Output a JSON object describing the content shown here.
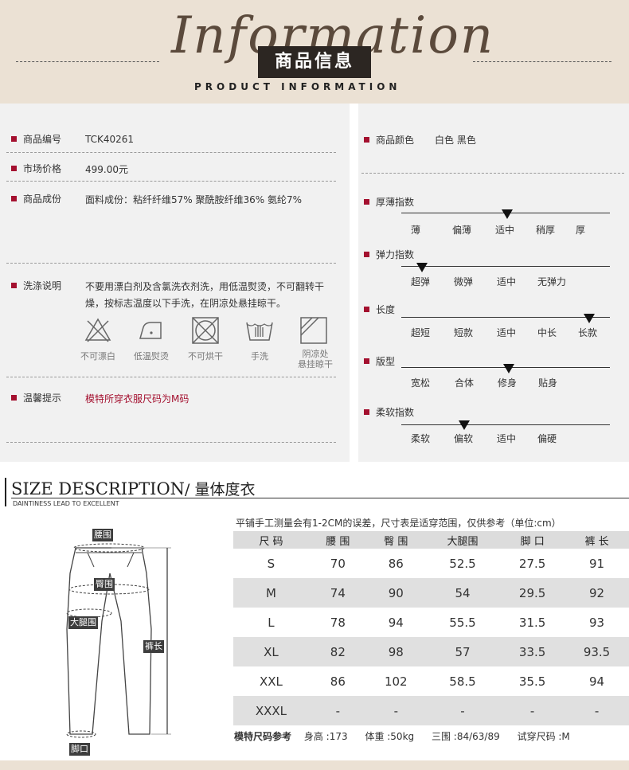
{
  "header": {
    "script_word": "Information",
    "title": "商品信息",
    "subtitle": "PRODUCT INFORMATION"
  },
  "left_panel": {
    "rows": [
      {
        "label": "商品编号",
        "value": "TCK40261"
      },
      {
        "label": "市场价格",
        "value": "499.00元"
      },
      {
        "label": "商品成份",
        "value": "面料成份：粘纤纤维57%  聚酰胺纤维36%  氨纶7%"
      },
      {
        "label": "洗涤说明",
        "value": "不要用漂白剂及含氯洗衣剂洗，用低温熨烫，不可翻转干燥，按标志温度以下手洗，在阴凉处悬挂晾干。"
      },
      {
        "label": "温馨提示",
        "value": "模特所穿衣服尺码为M码"
      }
    ],
    "care_icons": [
      {
        "icon": "no-bleach-icon",
        "label": "不可漂白"
      },
      {
        "icon": "low-iron-icon",
        "label": "低温熨烫"
      },
      {
        "icon": "no-tumble-dry-icon",
        "label": "不可烘干"
      },
      {
        "icon": "hand-wash-icon",
        "label": "手洗"
      },
      {
        "icon": "shade-dry-icon",
        "label_line1": "阴凉处",
        "label_line2": "悬挂晾干"
      }
    ]
  },
  "right_panel": {
    "color_label": "商品颜色",
    "color_value": "白色  黑色",
    "scales": [
      {
        "label": "厚薄指数",
        "ticks": [
          "薄",
          "偏薄",
          "适中",
          "稍厚",
          "厚"
        ],
        "selected": "适中"
      },
      {
        "label": "弹力指数",
        "ticks": [
          "超弹",
          "微弹",
          "适中",
          "无弹力"
        ],
        "selected": "超弹"
      },
      {
        "label": "长度",
        "ticks": [
          "超短",
          "短款",
          "适中",
          "中长",
          "长款"
        ],
        "selected": "长款"
      },
      {
        "label": "版型",
        "ticks": [
          "宽松",
          "合体",
          "修身",
          "贴身"
        ],
        "selected": "修身"
      },
      {
        "label": "柔软指数",
        "ticks": [
          "柔软",
          "偏软",
          "适中",
          "偏硬"
        ],
        "selected": "偏软"
      }
    ]
  },
  "size_section": {
    "title_en": "SIZE DESCRIPTION",
    "title_cn": "/ 量体度衣",
    "subtitle": "DAINTINESS LEAD TO EXCELLENT",
    "note": "平铺手工测量会有1-2CM的误差，尺寸表是适穿范围，仅供参考（单位:cm）",
    "diagram_tags": {
      "waist": "腰围",
      "hip": "臀围",
      "thigh": "大腿围",
      "length": "裤长",
      "hem": "脚口"
    },
    "table": {
      "headers": [
        "尺 码",
        "腰 围",
        "臀 围",
        "大腿围",
        "脚 口",
        "裤 长"
      ],
      "rows": [
        [
          "S",
          "70",
          "86",
          "52.5",
          "27.5",
          "91"
        ],
        [
          "M",
          "74",
          "90",
          "54",
          "29.5",
          "92"
        ],
        [
          "L",
          "78",
          "94",
          "55.5",
          "31.5",
          "93"
        ],
        [
          "XL",
          "82",
          "98",
          "57",
          "33.5",
          "93.5"
        ],
        [
          "XXL",
          "86",
          "102",
          "58.5",
          "35.5",
          "94"
        ],
        [
          "XXXL",
          "-",
          "-",
          "-",
          "-",
          "-"
        ]
      ]
    },
    "model_ref": {
      "label": "模特尺码参考",
      "height": "身高 :173",
      "weight": "体重 :50kg",
      "measurements": "三围 :84/63/89",
      "size": "试穿尺码 :M"
    }
  },
  "colors": {
    "accent": "#a4102f",
    "header_bg": "#ebe1d4",
    "panel_bg": "#f1f1f1"
  }
}
